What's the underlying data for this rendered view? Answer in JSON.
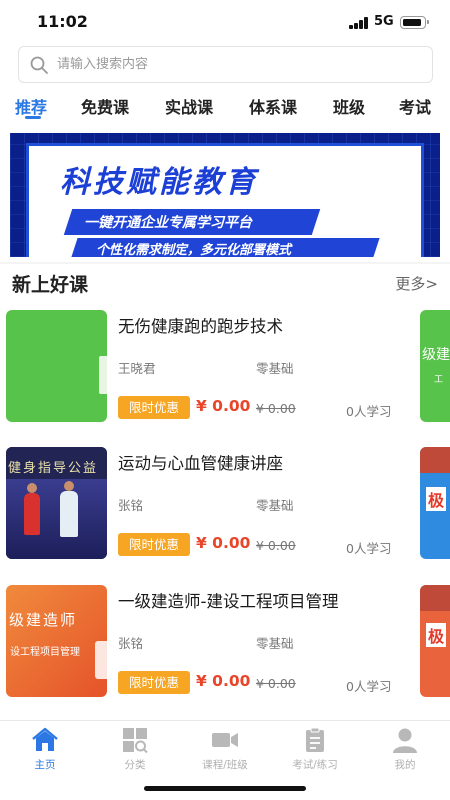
{
  "status_bar": {
    "time": "11:02",
    "network": "5G"
  },
  "search": {
    "placeholder": "请输入搜索内容"
  },
  "tabs": [
    {
      "label": "推荐",
      "active": true
    },
    {
      "label": "免费课"
    },
    {
      "label": "实战课"
    },
    {
      "label": "体系课"
    },
    {
      "label": "班级"
    },
    {
      "label": "考试"
    }
  ],
  "banner": {
    "title": "科技赋能教育",
    "subtitle1": "一键开通企业专属学习平台",
    "subtitle2": "个性化需求制定，多元化部署模式"
  },
  "section": {
    "title": "新上好课",
    "more": "更多>"
  },
  "courses": [
    {
      "title": "无伤健康跑的跑步技术",
      "teacher": "王晓君",
      "level": "零基础",
      "promo": "限时优惠",
      "price": "¥ 0.00",
      "original_price": "¥ 0.00",
      "learners": "0人学习"
    },
    {
      "title": "运动与心血管健康讲座",
      "teacher": "张铭",
      "level": "零基础",
      "promo": "限时优惠",
      "price": "¥ 0.00",
      "original_price": "¥ 0.00",
      "learners": "0人学习",
      "thumb_text": "健身指导公益"
    },
    {
      "title": "一级建造师-建设工程项目管理",
      "teacher": "张铭",
      "level": "零基础",
      "promo": "限时优惠",
      "price": "¥ 0.00",
      "original_price": "¥ 0.00",
      "learners": "0人学习",
      "thumb_text": "级建造师",
      "thumb_subtext": "设工程项目管理"
    }
  ],
  "peek_cards": [
    {
      "text": "级建",
      "sub": "工"
    },
    {
      "text": "极"
    },
    {
      "text": "极"
    }
  ],
  "bottom_nav": [
    {
      "label": "主页",
      "icon": "home-icon",
      "active": true
    },
    {
      "label": "分类",
      "icon": "category-icon"
    },
    {
      "label": "课程/班级",
      "icon": "video-icon"
    },
    {
      "label": "考试/练习",
      "icon": "exam-icon"
    },
    {
      "label": "我的",
      "icon": "profile-icon"
    }
  ],
  "colors": {
    "accent": "#2b78e4",
    "price": "#e8452a",
    "promo": "#f6a623"
  }
}
